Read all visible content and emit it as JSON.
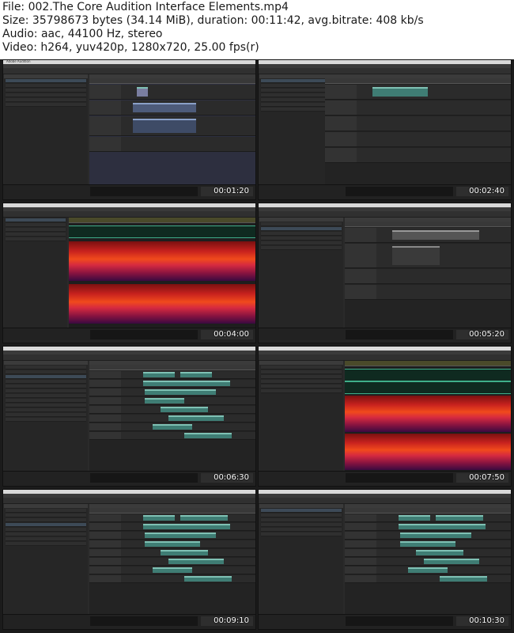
{
  "header": {
    "file": "File: 002.The Core Audition Interface Elements.mp4",
    "size": "Size: 35798673 bytes (34.14 MiB), duration: 00:11:42, avg.bitrate: 408 kb/s",
    "audio": "Audio: aac, 44100 Hz, stereo",
    "video": "Video: h264, yuv420p, 1280x720, 25.00 fps(r)"
  },
  "app": {
    "window_title": "Adobe Audition"
  },
  "thumbnails": [
    {
      "timestamp": "00:01:20",
      "view": "multitrack"
    },
    {
      "timestamp": "00:02:40",
      "view": "multitrack"
    },
    {
      "timestamp": "00:04:00",
      "view": "spectral"
    },
    {
      "timestamp": "00:05:20",
      "view": "multitrack"
    },
    {
      "timestamp": "00:06:30",
      "view": "multitrack"
    },
    {
      "timestamp": "00:07:50",
      "view": "spectral"
    },
    {
      "timestamp": "00:09:10",
      "view": "multitrack"
    },
    {
      "timestamp": "00:10:30",
      "view": "multitrack"
    }
  ],
  "colors": {
    "clip_green": "#3f7d74",
    "spectral_hot": "#f04a1c",
    "timestamp_text": "#ffffff"
  }
}
